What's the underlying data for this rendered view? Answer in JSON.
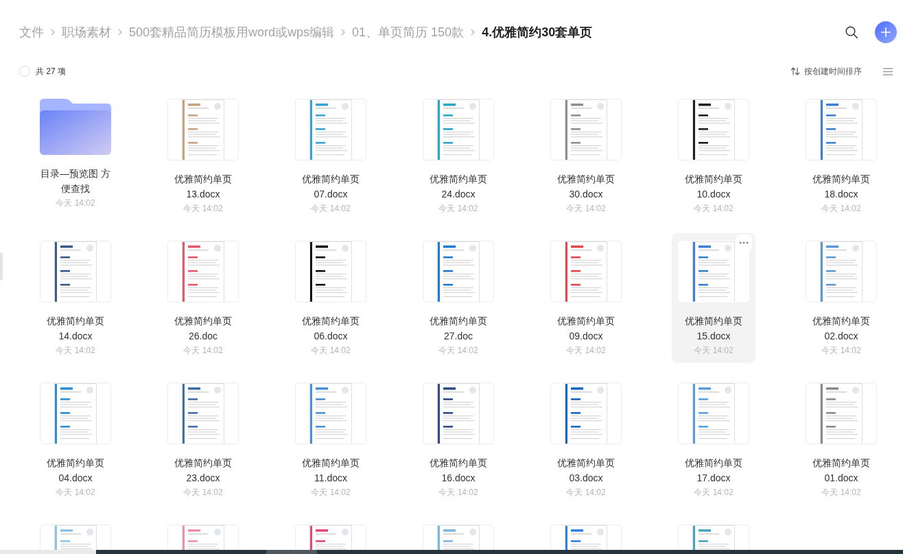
{
  "breadcrumb": [
    {
      "label": "文件",
      "current": false
    },
    {
      "label": "职场素材",
      "current": false
    },
    {
      "label": "500套精品简历模板用word或wps编辑",
      "current": false
    },
    {
      "label": "01、单页简历 150款",
      "current": false
    },
    {
      "label": "4.优雅简约30套单页",
      "current": true
    }
  ],
  "toolbar": {
    "select_all_checked": false,
    "count": "共 27 项",
    "sort": "按创建时间排序"
  },
  "items": [
    {
      "kind": "folder",
      "name": "目录—预览图 方便查找",
      "date": "今天 14:02",
      "hovered": false
    },
    {
      "kind": "file",
      "name": "优雅简约单页13.docx",
      "date": "今天 14:02",
      "color": "#c9a27e",
      "hovered": false
    },
    {
      "kind": "file",
      "name": "优雅简约单页07.docx",
      "date": "今天 14:02",
      "color": "#3aa3d3",
      "hovered": false
    },
    {
      "kind": "file",
      "name": "优雅简约单页24.docx",
      "date": "今天 14:02",
      "color": "#2aa6c9",
      "hovered": false
    },
    {
      "kind": "file",
      "name": "优雅简约单页30.docx",
      "date": "今天 14:02",
      "color": "#8f8f8f",
      "hovered": false
    },
    {
      "kind": "file",
      "name": "优雅简约单页10.docx",
      "date": "今天 14:02",
      "color": "#1f1f1f",
      "hovered": false
    },
    {
      "kind": "file",
      "name": "优雅简约单页18.docx",
      "date": "今天 14:02",
      "color": "#3d7fd6",
      "hovered": false
    },
    {
      "kind": "file",
      "name": "优雅简约单页14.docx",
      "date": "今天 14:02",
      "color": "#3c5a8f",
      "hovered": false
    },
    {
      "kind": "file",
      "name": "优雅简约单页26.doc",
      "date": "今天 14:02",
      "color": "#e9576b",
      "hovered": false
    },
    {
      "kind": "file",
      "name": "优雅简约单页06.docx",
      "date": "今天 14:02",
      "color": "#111111",
      "hovered": false
    },
    {
      "kind": "file",
      "name": "优雅简约单页27.doc",
      "date": "今天 14:02",
      "color": "#1f7ad1",
      "hovered": false
    },
    {
      "kind": "file",
      "name": "优雅简约单页09.docx",
      "date": "今天 14:02",
      "color": "#e5484d",
      "hovered": false
    },
    {
      "kind": "file",
      "name": "优雅简约单页15.docx",
      "date": "今天 14:02",
      "color": "#3b82d6",
      "hovered": true
    },
    {
      "kind": "file",
      "name": "优雅简约单页02.docx",
      "date": "今天 14:02",
      "color": "#5b9bd5",
      "hovered": false
    },
    {
      "kind": "file",
      "name": "优雅简约单页04.docx",
      "date": "今天 14:02",
      "color": "#2b8fd6",
      "hovered": false
    },
    {
      "kind": "file",
      "name": "优雅简约单页23.docx",
      "date": "今天 14:02",
      "color": "#3f6fa6",
      "hovered": false
    },
    {
      "kind": "file",
      "name": "优雅简约单页11.docx",
      "date": "今天 14:02",
      "color": "#4a90d9",
      "hovered": false
    },
    {
      "kind": "file",
      "name": "优雅简约单页16.docx",
      "date": "今天 14:02",
      "color": "#2d4b8a",
      "hovered": false
    },
    {
      "kind": "file",
      "name": "优雅简约单页03.docx",
      "date": "今天 14:02",
      "color": "#1467c0",
      "hovered": false
    },
    {
      "kind": "file",
      "name": "优雅简约单页17.docx",
      "date": "今天 14:02",
      "color": "#5aa0e0",
      "hovered": false
    },
    {
      "kind": "file",
      "name": "优雅简约单页01.docx",
      "date": "今天 14:02",
      "color": "#8a8a8a",
      "hovered": false
    },
    {
      "kind": "file",
      "color": "#8cc3e6",
      "hovered": false
    },
    {
      "kind": "file",
      "color": "#f28db0",
      "hovered": false
    },
    {
      "kind": "file",
      "color": "#e8457a",
      "hovered": false
    },
    {
      "kind": "file",
      "color": "#7eb7de",
      "hovered": false
    },
    {
      "kind": "file",
      "color": "#2f7fe8",
      "hovered": false
    },
    {
      "kind": "file",
      "color": "#45a6bd",
      "hovered": false
    }
  ]
}
